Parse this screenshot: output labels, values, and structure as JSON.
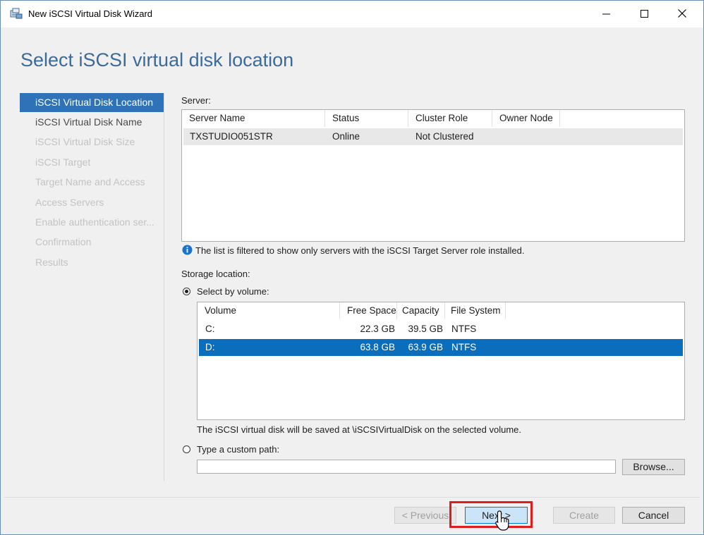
{
  "window": {
    "title": "New iSCSI Virtual Disk Wizard",
    "controls": {
      "minimize": "—",
      "maximize": "☐",
      "close": "✕"
    }
  },
  "page_title": "Select iSCSI virtual disk location",
  "nav": {
    "items": [
      {
        "label": "iSCSI Virtual Disk Location",
        "state": "active"
      },
      {
        "label": "iSCSI Virtual Disk Name",
        "state": "enabled"
      },
      {
        "label": "iSCSI Virtual Disk Size",
        "state": "disabled"
      },
      {
        "label": "iSCSI Target",
        "state": "disabled"
      },
      {
        "label": "Target Name and Access",
        "state": "disabled"
      },
      {
        "label": "Access Servers",
        "state": "disabled"
      },
      {
        "label": "Enable authentication ser...",
        "state": "disabled"
      },
      {
        "label": "Confirmation",
        "state": "disabled"
      },
      {
        "label": "Results",
        "state": "disabled"
      }
    ]
  },
  "server": {
    "label": "Server:",
    "columns": [
      "Server Name",
      "Status",
      "Cluster Role",
      "Owner Node"
    ],
    "rows": [
      {
        "name": "TXSTUDIO051STR",
        "status": "Online",
        "cluster_role": "Not Clustered",
        "owner_node": ""
      }
    ],
    "info_text": "The list is filtered to show only servers with the iSCSI Target Server role installed."
  },
  "storage": {
    "label": "Storage location:",
    "select_by_volume_label": "Select by volume:",
    "select_by_volume_checked": true,
    "columns": [
      "Volume",
      "Free Space",
      "Capacity",
      "File System"
    ],
    "rows": [
      {
        "volume": "C:",
        "free": "22.3 GB",
        "capacity": "39.5 GB",
        "fs": "NTFS",
        "selected": false
      },
      {
        "volume": "D:",
        "free": "63.8 GB",
        "capacity": "63.9 GB",
        "fs": "NTFS",
        "selected": true
      }
    ],
    "save_note": "The iSCSI virtual disk will be saved at \\iSCSIVirtualDisk on the selected volume.",
    "custom_path_label": "Type a custom path:",
    "custom_path_checked": false,
    "custom_path_value": "",
    "browse_label": "Browse..."
  },
  "footer": {
    "previous_label": "< Previous",
    "next_label": "Next >",
    "create_label": "Create",
    "cancel_label": "Cancel"
  },
  "colors": {
    "accent": "#2f72b8",
    "title_blue": "#3c6a9a",
    "selection": "#0a6ebd",
    "highlight_box": "#e01d1d",
    "info_icon": "#1a73c8"
  }
}
